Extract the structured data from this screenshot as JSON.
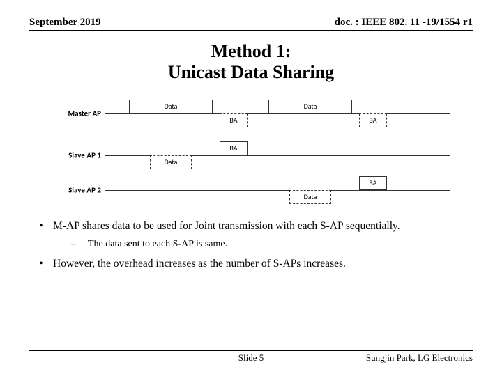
{
  "header": {
    "date": "September 2019",
    "docnum": "doc. : IEEE 802. 11 -19/1554 r1"
  },
  "title": {
    "line1": "Method 1:",
    "line2": "Unicast Data Sharing"
  },
  "diagram": {
    "rows": {
      "master": "Master AP",
      "slave1": "Slave AP 1",
      "slave2": "Slave AP 2"
    },
    "labels": {
      "data": "Data",
      "ba": "BA"
    }
  },
  "bullets": {
    "b1": "M-AP shares data to be used for Joint transmission with each S-AP sequentially.",
    "b2": "The data sent to each S-AP is same.",
    "b3": "However, the overhead increases as the number of S-APs increases."
  },
  "footer": {
    "slide": "Slide 5",
    "author": "Sungjin Park, LG Electronics"
  }
}
